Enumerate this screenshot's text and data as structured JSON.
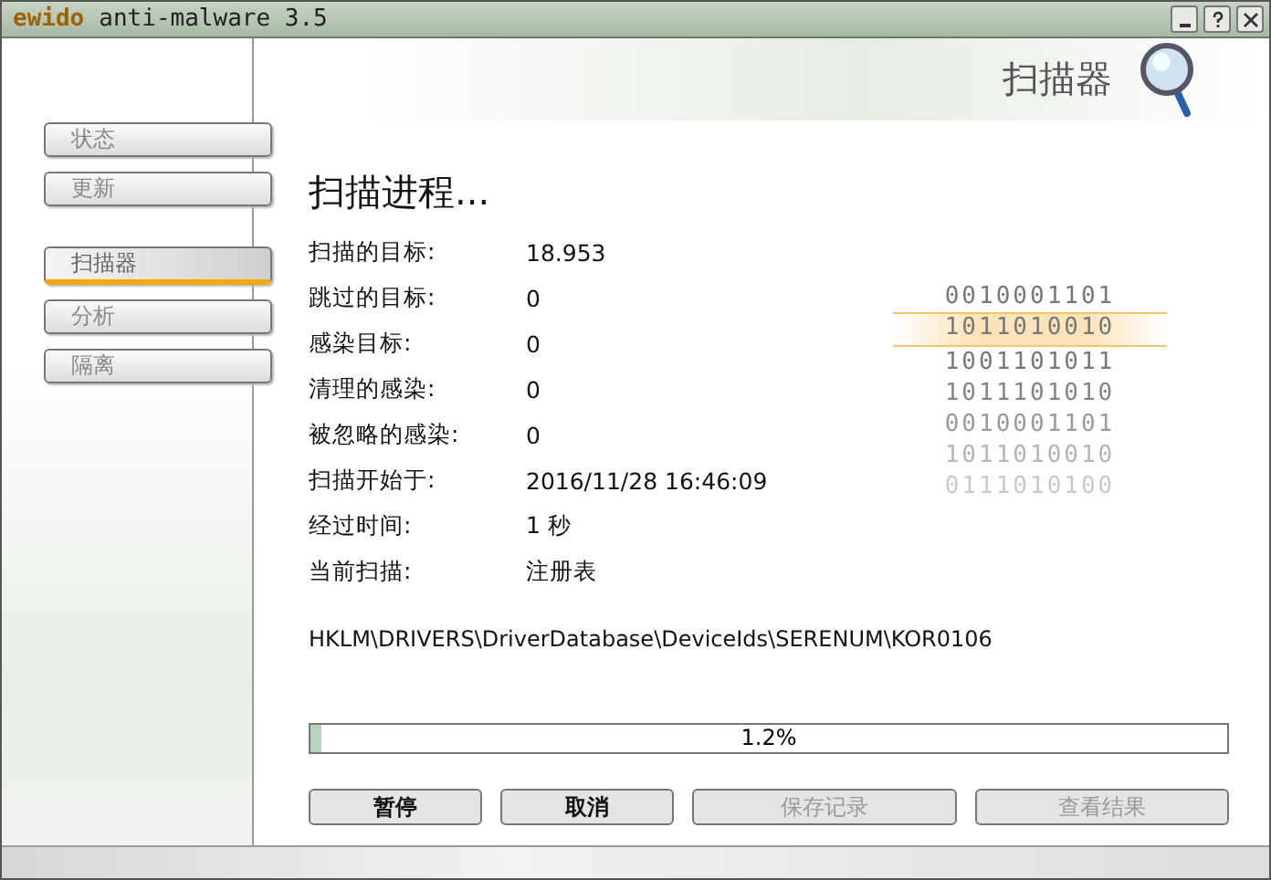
{
  "window": {
    "title_brand": "ewido",
    "title": "anti-malware 3.5"
  },
  "header": {
    "title": "扫描器"
  },
  "sidebar": {
    "groups": [
      [
        {
          "label": "状态",
          "selected": false
        },
        {
          "label": "更新",
          "selected": false
        }
      ],
      [
        {
          "label": "扫描器",
          "selected": true
        },
        {
          "label": "分析",
          "selected": false
        },
        {
          "label": "隔离",
          "selected": false
        }
      ]
    ]
  },
  "main": {
    "title": "扫描进程...",
    "fields": [
      {
        "label": "扫描的目标:",
        "value": "18.953"
      },
      {
        "label": "跳过的目标:",
        "value": "0"
      },
      {
        "label": "感染目标:",
        "value": "0"
      },
      {
        "label": "清理的感染:",
        "value": "0"
      },
      {
        "label": "被忽略的感染:",
        "value": "0"
      },
      {
        "label": "扫描开始于:",
        "value": "2016/11/28 16:46:09"
      },
      {
        "label": "经过时间:",
        "value": "1 秒"
      },
      {
        "label": "当前扫描:",
        "value": "注册表"
      }
    ],
    "current_path": "HKLM\\DRIVERS\\DriverDatabase\\DeviceIds\\SERENUM\\KOR0106",
    "binary_rows": [
      {
        "text": "0010001101",
        "selected": false
      },
      {
        "text": "1011010010",
        "selected": true
      },
      {
        "text": "1001101011",
        "selected": false
      },
      {
        "text": "1011101010",
        "selected": false
      },
      {
        "text": "0010001101",
        "selected": false
      },
      {
        "text": "1011010010",
        "selected": false
      },
      {
        "text": "0111010100",
        "selected": false
      }
    ],
    "progress": {
      "level": 0.012,
      "label": "1.2%"
    },
    "buttons": [
      {
        "label": "暂停",
        "disabled": false
      },
      {
        "label": "取消",
        "disabled": false
      },
      {
        "label": "保存记录",
        "disabled": true
      },
      {
        "label": "查看结果",
        "disabled": true
      }
    ]
  }
}
